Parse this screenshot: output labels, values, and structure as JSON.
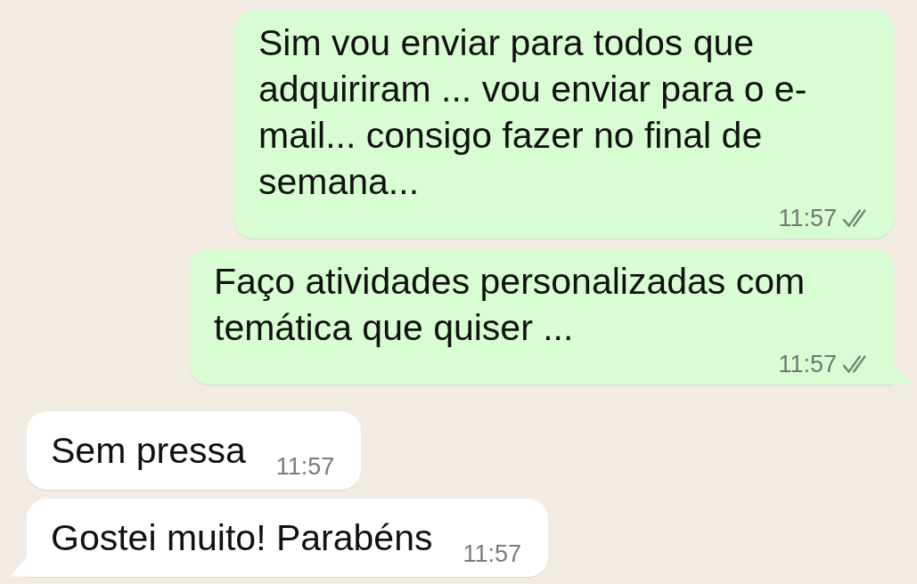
{
  "messages": [
    {
      "kind": "outgoing",
      "text": "Sim vou enviar para todos que adquiriram ... vou enviar para o e-mail... consigo fazer no final de semana...",
      "time": "11:57",
      "read": false,
      "tail": false
    },
    {
      "kind": "outgoing",
      "text": "Faço atividades personalizadas com temática que quiser ...",
      "time": "11:57",
      "read": false,
      "tail": true
    },
    {
      "kind": "incoming",
      "text": "Sem pressa",
      "time": "11:57",
      "tail": false
    },
    {
      "kind": "incoming",
      "text": "Gostei muito! Parabéns",
      "time": "11:57",
      "tail": true
    }
  ]
}
